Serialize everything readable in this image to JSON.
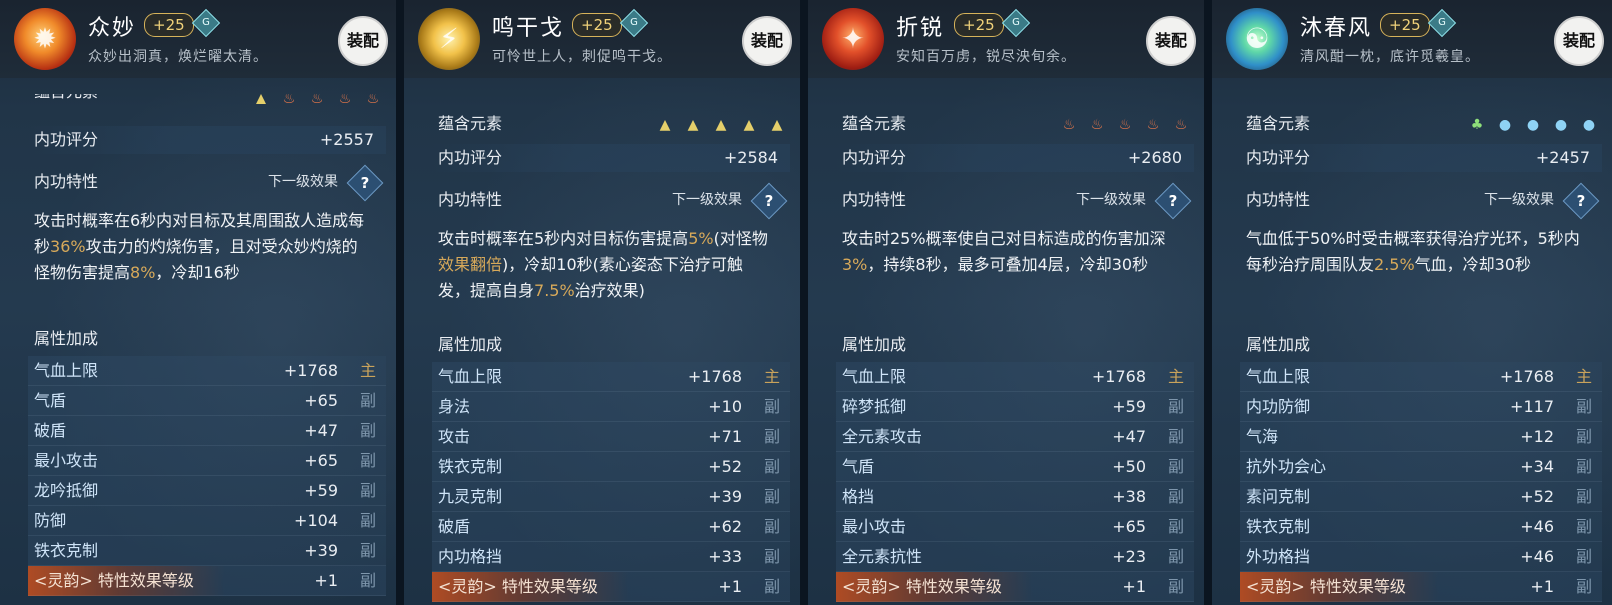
{
  "panels": [
    {
      "name": "众妙",
      "plus": "+25",
      "badge": "G",
      "subtitle": "众妙出洞真，焕烂曜太清。",
      "equip": "装配",
      "element_label": "蕴含元素",
      "elements": [
        "earth",
        "fire",
        "fire",
        "fire",
        "fire"
      ],
      "score_label": "内功评分",
      "score": "+2557",
      "trait_label": "内功特性",
      "next_label": "下一级效果",
      "help": "?",
      "desc": [
        {
          "t": "攻击时概率在6秒内对目标及其周围敌人造成每秒",
          "h": false
        },
        {
          "t": "36%",
          "h": true
        },
        {
          "t": "攻击力的灼烧伤害，且对受众妙灼烧的怪物伤害提高",
          "h": false
        },
        {
          "t": "8%",
          "h": true
        },
        {
          "t": "，冷却16秒",
          "h": false
        }
      ],
      "attr_label": "属性加成",
      "stats": [
        {
          "k": "气血上限",
          "v": "+1768",
          "t": "主",
          "main": true
        },
        {
          "k": "气盾",
          "v": "+65",
          "t": "副",
          "main": false
        },
        {
          "k": "破盾",
          "v": "+47",
          "t": "副",
          "main": false
        },
        {
          "k": "最小攻击",
          "v": "+65",
          "t": "副",
          "main": false
        },
        {
          "k": "龙吟抵御",
          "v": "+59",
          "t": "副",
          "main": false
        },
        {
          "k": "防御",
          "v": "+104",
          "t": "副",
          "main": false
        },
        {
          "k": "铁衣克制",
          "v": "+39",
          "t": "副",
          "main": false
        }
      ],
      "last": {
        "k": "<灵韵> 特性效果等级",
        "v": "+1",
        "t": "副"
      }
    },
    {
      "name": "鸣干戈",
      "plus": "+25",
      "badge": "G",
      "subtitle": "可怜世上人，刺促鸣干戈。",
      "equip": "装配",
      "element_label": "蕴含元素",
      "elements": [
        "earth",
        "earth",
        "earth",
        "earth",
        "earth"
      ],
      "score_label": "内功评分",
      "score": "+2584",
      "trait_label": "内功特性",
      "next_label": "下一级效果",
      "help": "?",
      "desc": [
        {
          "t": "攻击时概率在5秒内对目标伤害提高",
          "h": false
        },
        {
          "t": "5%",
          "h": true
        },
        {
          "t": "(对怪物",
          "h": false
        },
        {
          "t": "效果翻倍",
          "h": true
        },
        {
          "t": ")，冷却10秒(素心姿态下治疗可触发，提高自身",
          "h": false
        },
        {
          "t": "7.5%",
          "h": true
        },
        {
          "t": "治疗效果)",
          "h": false
        }
      ],
      "attr_label": "属性加成",
      "stats": [
        {
          "k": "气血上限",
          "v": "+1768",
          "t": "主",
          "main": true
        },
        {
          "k": "身法",
          "v": "+10",
          "t": "副",
          "main": false
        },
        {
          "k": "攻击",
          "v": "+71",
          "t": "副",
          "main": false
        },
        {
          "k": "铁衣克制",
          "v": "+52",
          "t": "副",
          "main": false
        },
        {
          "k": "九灵克制",
          "v": "+39",
          "t": "副",
          "main": false
        },
        {
          "k": "破盾",
          "v": "+62",
          "t": "副",
          "main": false
        },
        {
          "k": "内功格挡",
          "v": "+33",
          "t": "副",
          "main": false
        }
      ],
      "last": {
        "k": "<灵韵> 特性效果等级",
        "v": "+1",
        "t": "副"
      }
    },
    {
      "name": "折锐",
      "plus": "+25",
      "badge": "G",
      "subtitle": "安知百万虏，锐尽泱旬余。",
      "equip": "装配",
      "element_label": "蕴含元素",
      "elements": [
        "fire",
        "fire",
        "fire",
        "fire",
        "fire"
      ],
      "score_label": "内功评分",
      "score": "+2680",
      "trait_label": "内功特性",
      "next_label": "下一级效果",
      "help": "?",
      "desc": [
        {
          "t": "攻击时25%概率使自己对目标造成的伤害加深",
          "h": false
        },
        {
          "t": "3%",
          "h": true
        },
        {
          "t": "，持续8秒，最多可叠加4层，冷却30秒",
          "h": false
        }
      ],
      "attr_label": "属性加成",
      "stats": [
        {
          "k": "气血上限",
          "v": "+1768",
          "t": "主",
          "main": true
        },
        {
          "k": "碎梦抵御",
          "v": "+59",
          "t": "副",
          "main": false
        },
        {
          "k": "全元素攻击",
          "v": "+47",
          "t": "副",
          "main": false
        },
        {
          "k": "气盾",
          "v": "+50",
          "t": "副",
          "main": false
        },
        {
          "k": "格挡",
          "v": "+38",
          "t": "副",
          "main": false
        },
        {
          "k": "最小攻击",
          "v": "+65",
          "t": "副",
          "main": false
        },
        {
          "k": "全元素抗性",
          "v": "+23",
          "t": "副",
          "main": false
        }
      ],
      "last": {
        "k": "<灵韵> 特性效果等级",
        "v": "+1",
        "t": "副"
      }
    },
    {
      "name": "沐春风",
      "plus": "+25",
      "badge": "G",
      "subtitle": "清风酣一枕，底许觅羲皇。",
      "equip": "装配",
      "element_label": "蕴含元素",
      "elements": [
        "wood",
        "water",
        "water",
        "water",
        "water"
      ],
      "score_label": "内功评分",
      "score": "+2457",
      "trait_label": "内功特性",
      "next_label": "下一级效果",
      "help": "?",
      "desc": [
        {
          "t": "气血低于50%时受击概率获得治疗光环，5秒内每秒治疗周围队友",
          "h": false
        },
        {
          "t": "2.5%",
          "h": true
        },
        {
          "t": "气血，冷却30秒",
          "h": false
        }
      ],
      "attr_label": "属性加成",
      "stats": [
        {
          "k": "气血上限",
          "v": "+1768",
          "t": "主",
          "main": true
        },
        {
          "k": "内功防御",
          "v": "+117",
          "t": "副",
          "main": false
        },
        {
          "k": "气海",
          "v": "+12",
          "t": "副",
          "main": false
        },
        {
          "k": "抗外功会心",
          "v": "+34",
          "t": "副",
          "main": false
        },
        {
          "k": "素问克制",
          "v": "+52",
          "t": "副",
          "main": false
        },
        {
          "k": "铁衣克制",
          "v": "+46",
          "t": "副",
          "main": false
        },
        {
          "k": "外功格挡",
          "v": "+46",
          "t": "副",
          "main": false
        }
      ],
      "last": {
        "k": "<灵韵> 特性效果等级",
        "v": "+1",
        "t": "副"
      }
    }
  ]
}
